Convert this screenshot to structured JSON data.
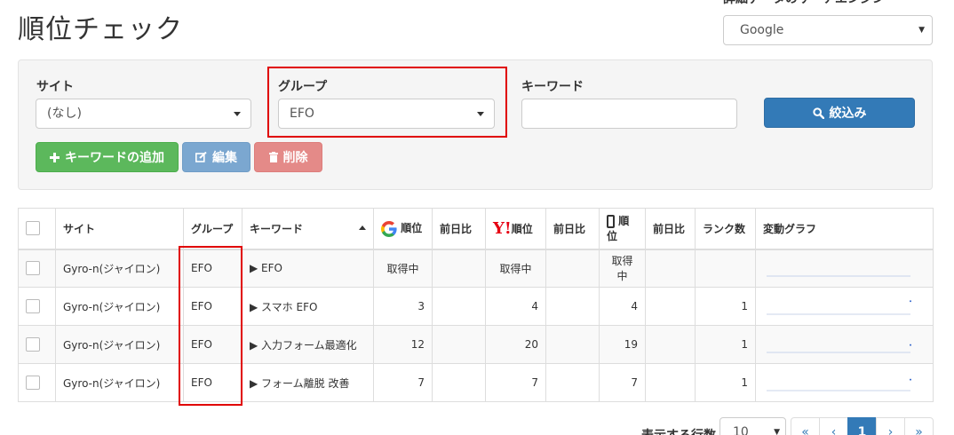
{
  "page": {
    "title": "順位チェック"
  },
  "engine": {
    "label": "詳細データのサーチエンジン",
    "selected": "Google"
  },
  "filters": {
    "site_label": "サイト",
    "site_value": "(なし)",
    "group_label": "グループ",
    "group_value": "EFO",
    "keyword_label": "キーワード",
    "keyword_value": "",
    "filter_button": "絞込み"
  },
  "actions": {
    "add_keyword": "キーワードの追加",
    "edit": "編集",
    "delete": "削除"
  },
  "table": {
    "headers": {
      "site": "サイト",
      "group": "グループ",
      "keyword": "キーワード",
      "google_rank": "順位",
      "google_prev": "前日比",
      "yahoo_rank": "順位",
      "yahoo_prev": "前日比",
      "mobile_rank": "順位",
      "mobile_prev": "前日比",
      "rank_count": "ランク数",
      "graph": "変動グラフ"
    },
    "rows": [
      {
        "site": "Gyro-n(ジャイロン)",
        "group": "EFO",
        "keyword": "▶ EFO",
        "google_rank": "取得中",
        "google_prev": "",
        "yahoo_rank": "取得中",
        "yahoo_prev": "",
        "mobile_rank": "取得中",
        "mobile_prev": "",
        "rank_count": "",
        "trend": null
      },
      {
        "site": "Gyro-n(ジャイロン)",
        "group": "EFO",
        "keyword": "▶ スマホ EFO",
        "google_rank": "3",
        "google_prev": "",
        "yahoo_rank": "4",
        "yahoo_prev": "",
        "mobile_rank": "4",
        "mobile_prev": "",
        "rank_count": "1",
        "trend": 4
      },
      {
        "site": "Gyro-n(ジャイロン)",
        "group": "EFO",
        "keyword": "▶ 入力フォーム最適化",
        "google_rank": "12",
        "google_prev": "",
        "yahoo_rank": "20",
        "yahoo_prev": "",
        "mobile_rank": "19",
        "mobile_prev": "",
        "rank_count": "1",
        "trend": 12
      },
      {
        "site": "Gyro-n(ジャイロン)",
        "group": "EFO",
        "keyword": "▶ フォーム離脱 改善",
        "google_rank": "7",
        "google_prev": "",
        "yahoo_rank": "7",
        "yahoo_prev": "",
        "mobile_rank": "7",
        "mobile_prev": "",
        "rank_count": "1",
        "trend": 7
      }
    ]
  },
  "pagination": {
    "rows_label": "表示する行数",
    "rows_value": "10",
    "first": "«",
    "prev": "‹",
    "current": "1",
    "next": "›",
    "last": "»"
  },
  "colors": {
    "primary": "#337ab7",
    "success": "#5cb85c",
    "info": "#7ba7d0",
    "danger": "#e48a88",
    "highlight": "#e00000",
    "spark": "#3366cc"
  }
}
